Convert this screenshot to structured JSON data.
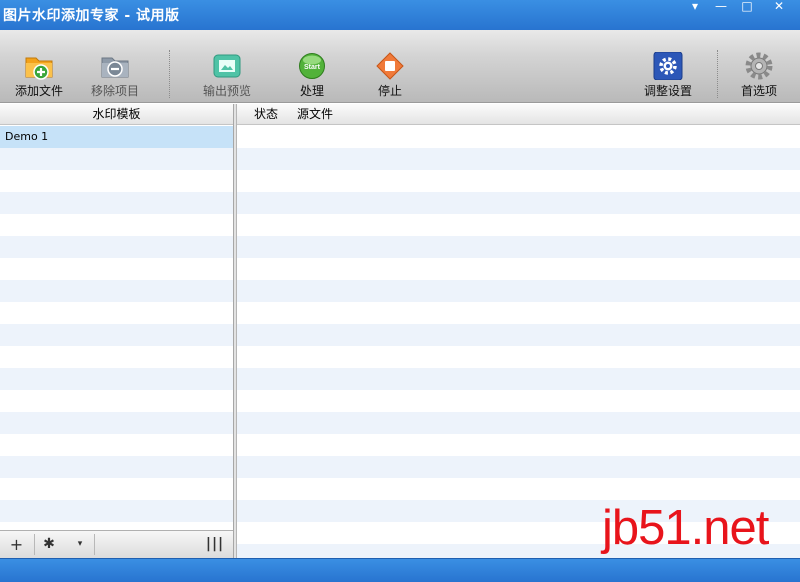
{
  "window": {
    "title": "图片水印添加专家 - 试用版",
    "controls": {
      "menu": "▾",
      "minimize": "—",
      "maximize": "□",
      "close": "✕"
    }
  },
  "toolbar": {
    "add_file": "添加文件",
    "remove_item": "移除项目",
    "output_preview": "输出预览",
    "process": "处理",
    "process_icon_text": "Start",
    "stop": "停止",
    "adjust_settings": "调整设置",
    "preferences": "首选项"
  },
  "left_panel": {
    "header": "水印模板",
    "templates": [
      "Demo 1"
    ],
    "tools": {
      "add": "+",
      "gear": "✱",
      "dropdown": "▾",
      "columns": "|||"
    }
  },
  "right_panel": {
    "columns": {
      "status": "状态",
      "source_file": "源文件"
    }
  },
  "watermark": "jb51.net",
  "colors": {
    "titlebar": "#2f80dc",
    "selected_row": "#c6e2f8",
    "alt_row": "#edf3fb",
    "watermark": "#e8141b"
  }
}
